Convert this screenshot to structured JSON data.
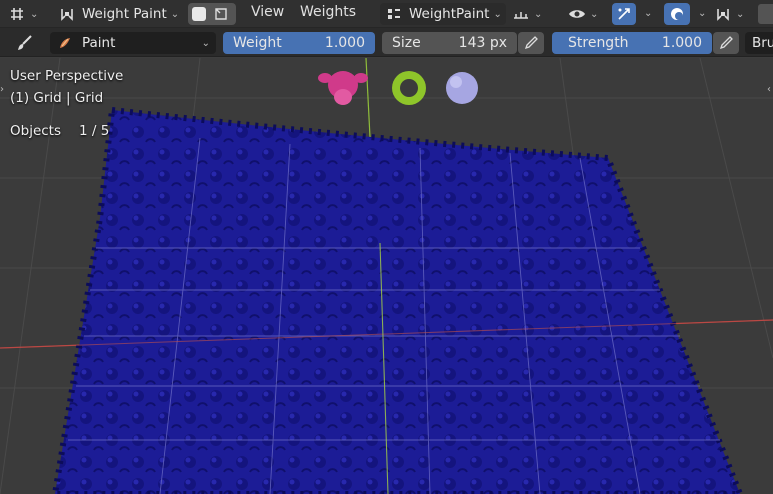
{
  "header": {
    "mode": "Weight Paint",
    "menus": [
      "View",
      "Weights"
    ],
    "workspace": "WeightPaint",
    "icons": [
      "editor-type-icon",
      "mode-icon",
      "xray-icon",
      "overlay-icon",
      "visibility-icon",
      "gizmo-icon",
      "shading-icon",
      "snap-icon"
    ]
  },
  "toolsettings": {
    "brush_name": "Paint",
    "weight_label": "Weight",
    "weight_value": "1.000",
    "size_label": "Size",
    "size_value": "143 px",
    "strength_label": "Strength",
    "strength_value": "1.000",
    "brush_menu": "Bru"
  },
  "overlay": {
    "view_name": "User Perspective",
    "object_info": "(1) Grid | Grid",
    "objects_label": "Objects",
    "objects_value": "1 / 5"
  },
  "colors": {
    "header_bg": "#303030",
    "accent": "#4772b3",
    "mesh_blue": "#1c1c96",
    "x_axis": "#b3403c",
    "y_axis": "#8fbd3a"
  },
  "scene_objects": [
    "monkey-icon",
    "gear-icon",
    "sphere-icon"
  ]
}
